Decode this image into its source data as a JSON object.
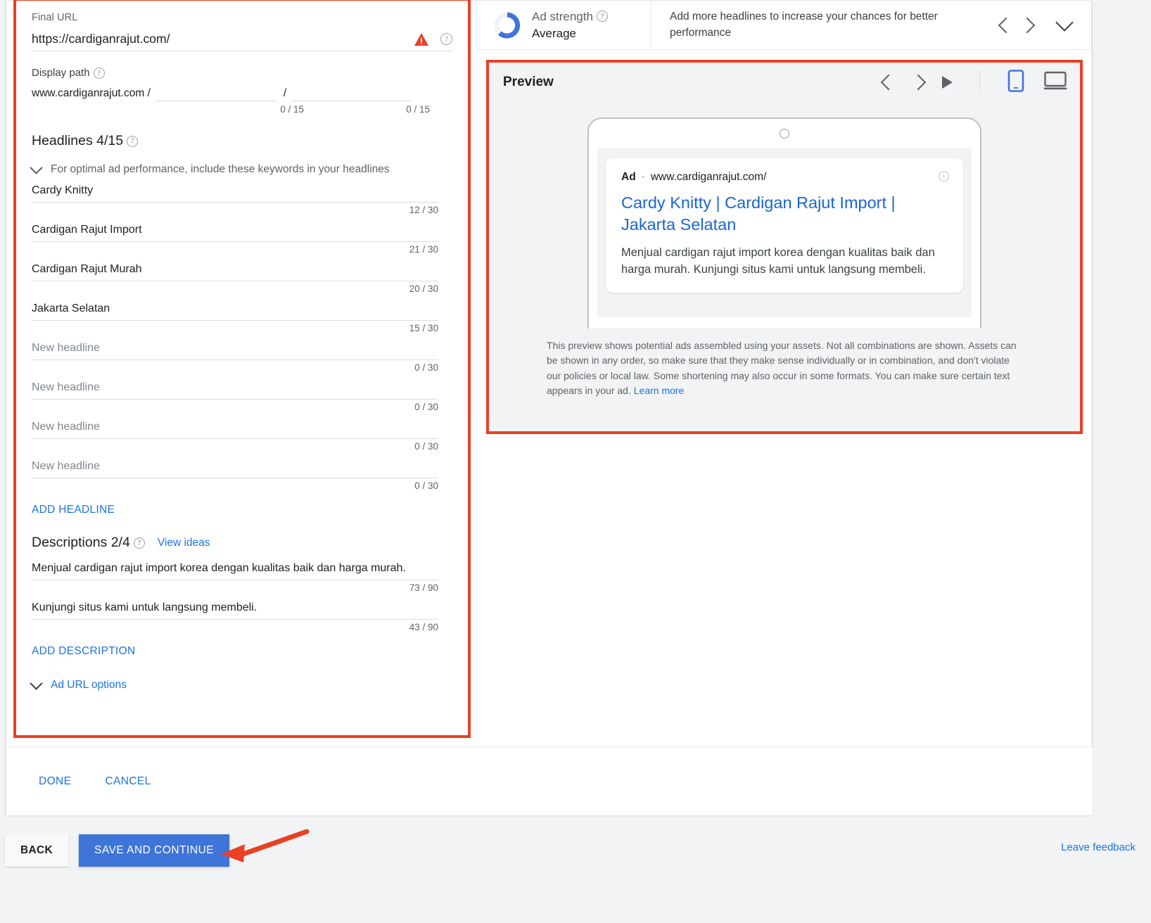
{
  "editor": {
    "final_url": {
      "label": "Final URL",
      "value": "https://cardiganrajut.com/",
      "warning_icon": "warning-triangle-icon",
      "help_icon": "help-icon"
    },
    "display_path": {
      "label": "Display path",
      "domain": "www.cardiganrajut.com /",
      "separator": "/",
      "path1_value": "",
      "path1_count": "0 / 15",
      "path2_value": "",
      "path2_count": "0 / 15"
    },
    "headlines": {
      "title": "Headlines 4/15",
      "keyword_hint": "For optimal ad performance, include these keywords in your headlines",
      "items": [
        {
          "value": "Cardy Knitty",
          "placeholder": "New headline",
          "count": "12 / 30",
          "filled": true
        },
        {
          "value": "Cardigan Rajut Import",
          "placeholder": "New headline",
          "count": "21 / 30",
          "filled": true
        },
        {
          "value": "Cardigan Rajut Murah",
          "placeholder": "New headline",
          "count": "20 / 30",
          "filled": true
        },
        {
          "value": "Jakarta Selatan",
          "placeholder": "New headline",
          "count": "15 / 30",
          "filled": true
        },
        {
          "value": "",
          "placeholder": "New headline",
          "count": "0 / 30",
          "filled": false
        },
        {
          "value": "",
          "placeholder": "New headline",
          "count": "0 / 30",
          "filled": false
        },
        {
          "value": "",
          "placeholder": "New headline",
          "count": "0 / 30",
          "filled": false
        },
        {
          "value": "",
          "placeholder": "New headline",
          "count": "0 / 30",
          "filled": false
        }
      ],
      "add_label": "ADD HEADLINE"
    },
    "descriptions": {
      "title": "Descriptions 2/4",
      "view_ideas": "View ideas",
      "items": [
        {
          "value": "Menjual cardigan rajut import korea dengan kualitas baik dan harga murah.",
          "count": "73 / 90"
        },
        {
          "value": "Kunjungi situs kami untuk langsung membeli.",
          "count": "43 / 90"
        }
      ],
      "add_label": "ADD DESCRIPTION"
    },
    "ad_url_options": "Ad URL options",
    "done_label": "DONE",
    "cancel_label": "CANCEL"
  },
  "ad_strength": {
    "title": "Ad strength",
    "value": "Average",
    "message": "Add more headlines to increase your chances for better performance",
    "accent_color": "#3f74d8",
    "track_color": "#f1f3f4"
  },
  "preview": {
    "title": "Preview",
    "device_mobile_icon": "mobile-device-icon",
    "device_desktop_icon": "desktop-device-icon",
    "active_device": "mobile",
    "ad": {
      "badge": "Ad",
      "separator": "·",
      "url": "www.cardiganrajut.com/",
      "headline": "Cardy Knitty | Cardigan Rajut Import | Jakarta Selatan",
      "description": "Menjual cardigan rajut import korea dengan kualitas baik dan harga murah. Kunjungi situs kami untuk langsung membeli."
    },
    "note": "This preview shows potential ads assembled using your assets. Not all combinations are shown. Assets can be shown in any order, so make sure that they make sense individually or in combination, and don't violate our policies or local law. Some shortening may also occur in some formats. You can make sure certain text appears in your ad.",
    "note_link": "Learn more"
  },
  "bottom": {
    "back_label": "BACK",
    "save_label": "SAVE AND CONTINUE",
    "leave_feedback": "Leave feedback"
  }
}
